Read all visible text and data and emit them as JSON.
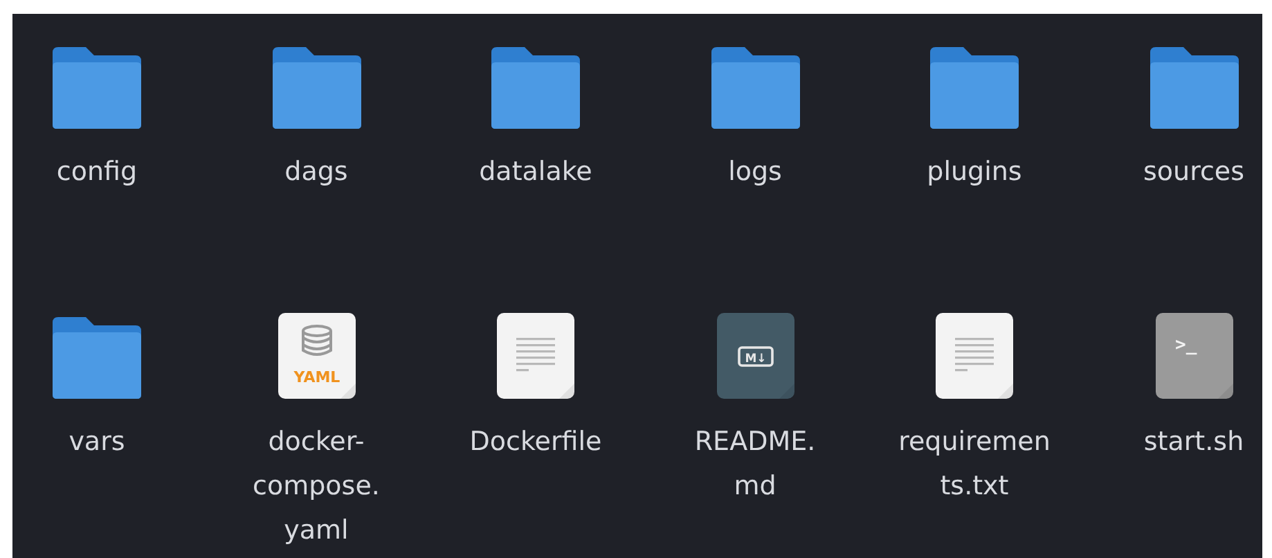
{
  "items": [
    {
      "kind": "folder",
      "label_lines": [
        "config"
      ]
    },
    {
      "kind": "folder",
      "label_lines": [
        "dags"
      ]
    },
    {
      "kind": "folder",
      "label_lines": [
        "datalake"
      ]
    },
    {
      "kind": "folder",
      "label_lines": [
        "logs"
      ]
    },
    {
      "kind": "folder",
      "label_lines": [
        "plugins"
      ]
    },
    {
      "kind": "folder",
      "label_lines": [
        "sources"
      ]
    },
    {
      "kind": "folder",
      "label_lines": [
        "vars"
      ]
    },
    {
      "kind": "yaml",
      "icon_text": "YAML",
      "label_lines": [
        "docker-",
        "compose.",
        "yaml"
      ]
    },
    {
      "kind": "text",
      "label_lines": [
        "Dockerfile"
      ]
    },
    {
      "kind": "markdown",
      "icon_text": "M↓",
      "label_lines": [
        "README.",
        "md"
      ]
    },
    {
      "kind": "text",
      "label_lines": [
        "requiremen",
        "ts.txt"
      ]
    },
    {
      "kind": "script",
      "icon_text": ">_",
      "label_lines": [
        "start.sh"
      ]
    }
  ]
}
